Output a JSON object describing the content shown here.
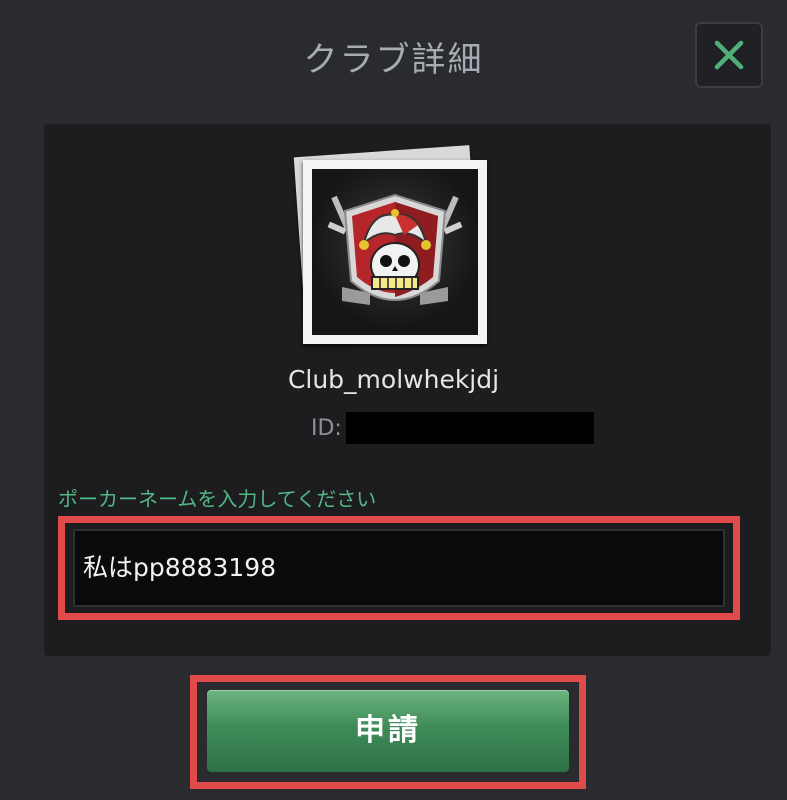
{
  "dialog": {
    "title": "クラブ詳細",
    "close_icon": "close-icon"
  },
  "club": {
    "logo_icon": "jester-skull-crest",
    "name": "Club_molwhekjdj",
    "id_label": "ID:"
  },
  "form": {
    "prompt": "ポーカーネームを入力してください",
    "input_value": "私はpp8883198"
  },
  "actions": {
    "submit_label": "申請"
  },
  "colors": {
    "accent_green": "#52b784",
    "highlight_red": "#e04a4a",
    "button_green": "#3f8c58",
    "close_x": "#4fb07a"
  }
}
